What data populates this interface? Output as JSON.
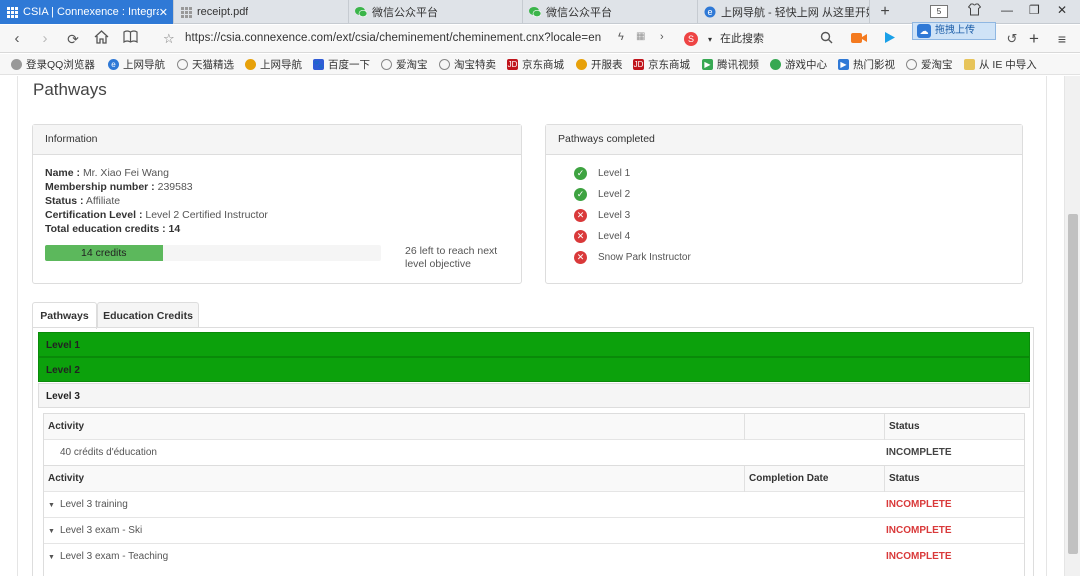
{
  "browser": {
    "tabs": [
      {
        "label": "CSIA | Connexence : Integrate",
        "icon": "grid-icon",
        "active": true
      },
      {
        "label": "receipt.pdf",
        "icon": "document-icon",
        "active": false
      },
      {
        "label": "微信公众平台",
        "icon": "wechat-icon",
        "active": false
      },
      {
        "label": "微信公众平台",
        "icon": "wechat-icon",
        "active": false
      },
      {
        "label": "上网导航 - 轻快上网 从这里开始",
        "icon": "ie-icon",
        "active": false
      }
    ],
    "new_tab": "+",
    "tab_count": "5",
    "upload_popup": "拖拽上传",
    "url_prefix": "https://",
    "url_domain": "csia.connexence.com",
    "url_path": "/ext/csia/cheminement/cheminement.cnx?locale=en",
    "search_placeholder": "在此搜索",
    "bookmarks": [
      {
        "label": "登录QQ浏览器",
        "icon": "user-icon",
        "color": "#888888"
      },
      {
        "label": "上网导航",
        "icon": "ie-icon",
        "color": "#2f79d6"
      },
      {
        "label": "天猫精选",
        "icon": "globe-icon",
        "color": "#888888"
      },
      {
        "label": "上网导航",
        "icon": "navigation-icon",
        "color": "#e7a10a"
      },
      {
        "label": "百度一下",
        "icon": "baidu-icon",
        "color": "#2f5bd6"
      },
      {
        "label": "爱淘宝",
        "icon": "globe-icon",
        "color": "#888888"
      },
      {
        "label": "淘宝特卖",
        "icon": "globe-icon",
        "color": "#888888"
      },
      {
        "label": "京东商城",
        "icon": "jd-icon",
        "color": "#c0141b"
      },
      {
        "label": "开服表",
        "icon": "game-icon",
        "color": "#e7a10a"
      },
      {
        "label": "京东商城",
        "icon": "jd-icon",
        "color": "#c0141b"
      },
      {
        "label": "腾讯视频",
        "icon": "video-icon",
        "color": "#36a852"
      },
      {
        "label": "游戏中心",
        "icon": "gamepad-icon",
        "color": "#36a852"
      },
      {
        "label": "热门影视",
        "icon": "play-icon",
        "color": "#2f79d6"
      },
      {
        "label": "爱淘宝",
        "icon": "globe-icon",
        "color": "#888888"
      },
      {
        "label": "从 IE 中导入",
        "icon": "folder-icon",
        "color": "#e7c45a"
      }
    ]
  },
  "page": {
    "title": "Pathways",
    "info_panel": {
      "heading": "Information",
      "name_label": "Name :",
      "name_value": "Mr. Xiao Fei Wang",
      "membership_label": "Membership number :",
      "membership_value": "239583",
      "status_label": "Status :",
      "status_value": "Affiliate",
      "cert_label": "Certification Level :",
      "cert_value": "Level 2 Certified Instructor",
      "credits_label": "Total education credits :",
      "credits_value": "14",
      "progress_label": "14 credits",
      "progress_fraction": 0.35,
      "progress_note": "26 left to reach next level objective"
    },
    "pathways_panel": {
      "heading": "Pathways completed",
      "items": [
        {
          "label": "Level 1",
          "completed": true
        },
        {
          "label": "Level 2",
          "completed": true
        },
        {
          "label": "Level 3",
          "completed": false
        },
        {
          "label": "Level 4",
          "completed": false
        },
        {
          "label": "Snow Park Instructor",
          "completed": false
        }
      ]
    },
    "tabs": [
      {
        "label": "Pathways",
        "active": true
      },
      {
        "label": "Education Credits",
        "active": false
      }
    ],
    "levels": [
      {
        "label": "Level 1",
        "status": "complete"
      },
      {
        "label": "Level 2",
        "status": "complete"
      },
      {
        "label": "Level 3",
        "status": "open"
      }
    ],
    "level3": {
      "credit_table": {
        "headers": {
          "activity": "Activity",
          "blank": "",
          "status": "Status"
        },
        "rows": [
          {
            "activity": "40 crédits d'éducation",
            "status": "INCOMPLETE"
          }
        ]
      },
      "activity_table": {
        "headers": {
          "activity": "Activity",
          "completion_date": "Completion Date",
          "status": "Status"
        },
        "rows": [
          {
            "activity": "Level 3 training",
            "completion_date": "",
            "status": "INCOMPLETE"
          },
          {
            "activity": "Level 3 exam - Ski",
            "completion_date": "",
            "status": "INCOMPLETE"
          },
          {
            "activity": "Level 3 exam - Teaching",
            "completion_date": "",
            "status": "INCOMPLETE"
          }
        ]
      }
    }
  },
  "colors": {
    "accent_blue": "#2f79d6",
    "complete_green": "#0ca10c",
    "progress_green": "#5cb85c",
    "incomplete_red": "#d9393a"
  }
}
